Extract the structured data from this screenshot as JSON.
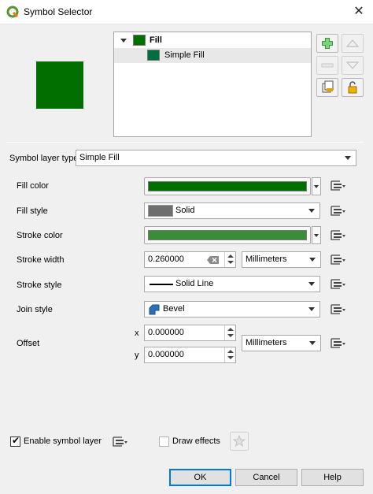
{
  "window": {
    "title": "Symbol Selector",
    "close_glyph": "✕"
  },
  "colors": {
    "fill": "#006f00",
    "stroke": "#3a8c3a",
    "fill_style_swatch": "#6e6e6e",
    "preview": "#006f00",
    "simple_fill_swatch": "#006f40"
  },
  "tree": {
    "items": [
      {
        "label": "Fill",
        "icon": "fill-symbol-icon",
        "expanded": true
      },
      {
        "label": "Simple Fill",
        "icon": "simple-fill-layer-icon",
        "selected": true
      }
    ]
  },
  "side_buttons": [
    {
      "icon": "add-layer-icon",
      "enabled": true
    },
    {
      "icon": "move-up-icon",
      "enabled": false
    },
    {
      "icon": "remove-layer-icon",
      "enabled": false
    },
    {
      "icon": "move-down-icon",
      "enabled": false
    },
    {
      "icon": "duplicate-layer-icon",
      "enabled": true
    },
    {
      "icon": "lock-icon",
      "enabled": true
    }
  ],
  "layer_type": {
    "label": "Symbol layer type",
    "value": "Simple Fill"
  },
  "properties": {
    "fill_color": {
      "label": "Fill color"
    },
    "fill_style": {
      "label": "Fill style",
      "value": "Solid"
    },
    "stroke_color": {
      "label": "Stroke color"
    },
    "stroke_width": {
      "label": "Stroke width",
      "value": "0.260000",
      "unit": "Millimeters"
    },
    "stroke_style": {
      "label": "Stroke style",
      "value": "Solid Line"
    },
    "join_style": {
      "label": "Join style",
      "value": "Bevel"
    },
    "offset": {
      "label": "Offset",
      "x_label": "x",
      "x_value": "0.000000",
      "y_label": "y",
      "y_value": "0.000000",
      "unit": "Millimeters"
    }
  },
  "footer": {
    "enable_layer": {
      "label": "Enable symbol layer",
      "checked": true
    },
    "draw_effects": {
      "label": "Draw effects",
      "checked": false,
      "enabled": false
    },
    "buttons": {
      "ok": "OK",
      "cancel": "Cancel",
      "help": "Help"
    }
  }
}
